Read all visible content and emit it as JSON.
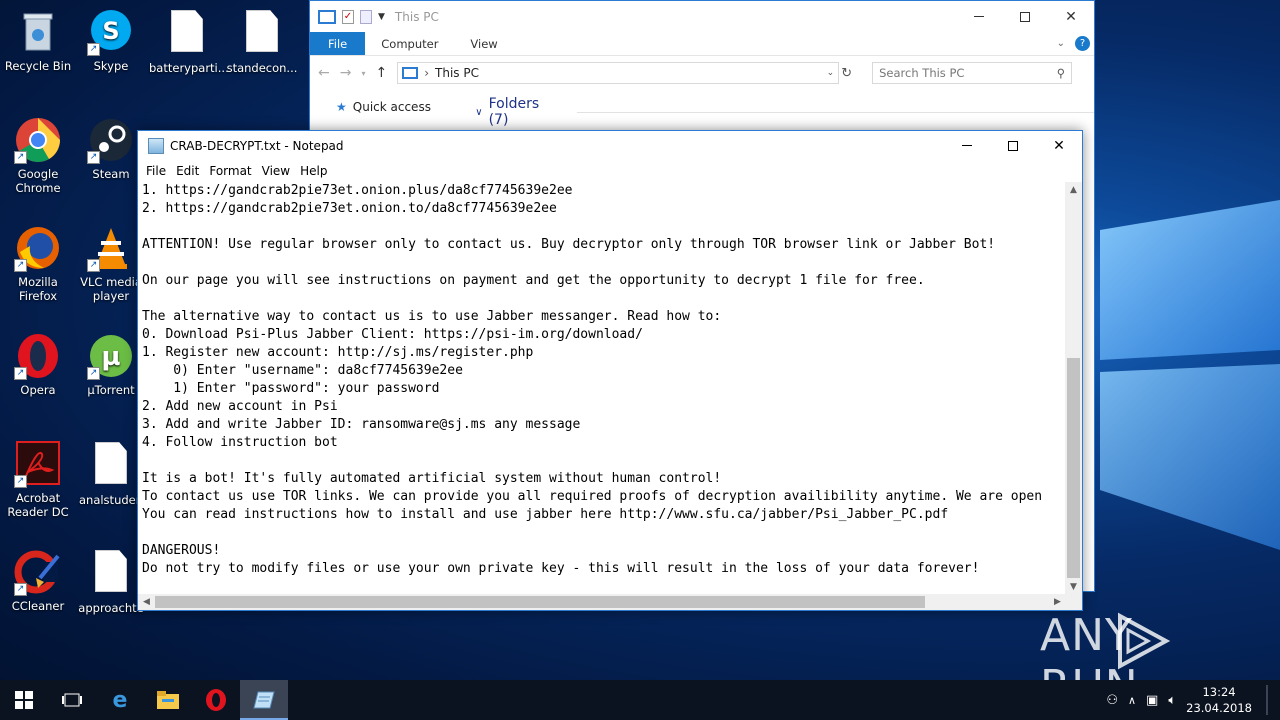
{
  "desktop": {
    "icons": [
      {
        "label": "Recycle Bin"
      },
      {
        "label": "Skype"
      },
      {
        "label": "batterypartі..."
      },
      {
        "label": "standecon..."
      },
      {
        "label": "Google Chrome"
      },
      {
        "label": "Steam"
      },
      {
        "label": "Mozilla Firefox"
      },
      {
        "label": "VLC media player"
      },
      {
        "label": "Opera"
      },
      {
        "label": "µTorrent"
      },
      {
        "label": "Acrobat Reader DC"
      },
      {
        "label": "analstuden"
      },
      {
        "label": "CCleaner"
      },
      {
        "label": "approachte"
      }
    ]
  },
  "explorer": {
    "title": "This PC",
    "tabs": [
      "File",
      "Computer",
      "View"
    ],
    "address": "This PC",
    "search_placeholder": "Search This PC",
    "nav": {
      "quick_access": "Quick access"
    },
    "folders_header": "Folders (7)"
  },
  "notepad": {
    "title": "CRAB-DECRYPT.txt - Notepad",
    "menu": [
      "File",
      "Edit",
      "Format",
      "View",
      "Help"
    ],
    "lines": [
      "1. https://gandcrab2pie73et.onion.plus/da8cf7745639e2ee",
      "2. https://gandcrab2pie73et.onion.to/da8cf7745639e2ee",
      "",
      "ATTENTION! Use regular browser only to contact us. Buy decryptor only through TOR browser link or Jabber Bot!",
      "",
      "On our page you will see instructions on payment and get the opportunity to decrypt 1 file for free.",
      "",
      "The alternative way to contact us is to use Jabber messanger. Read how to:",
      "0. Download Psi-Plus Jabber Client: https://psi-im.org/download/",
      "1. Register new account: http://sj.ms/register.php",
      "    0) Enter \"username\": da8cf7745639e2ee",
      "    1) Enter \"password\": your password",
      "2. Add new account in Psi",
      "3. Add and write Jabber ID: ransomware@sj.ms any message",
      "4. Follow instruction bot",
      "",
      "It is a bot! It's fully automated artificial system without human control!",
      "To contact us use TOR links. We can provide you all required proofs of decryption availibility anytime. We are open",
      "You can read instructions how to install and use jabber here http://www.sfu.ca/jabber/Psi_Jabber_PC.pdf",
      "",
      "DANGEROUS!",
      "Do not try to modify files or use your own private key - this will result in the loss of your data forever!"
    ]
  },
  "taskbar": {
    "time": "13:24",
    "date": "23.04.2018"
  },
  "watermark": "ANY RUN"
}
